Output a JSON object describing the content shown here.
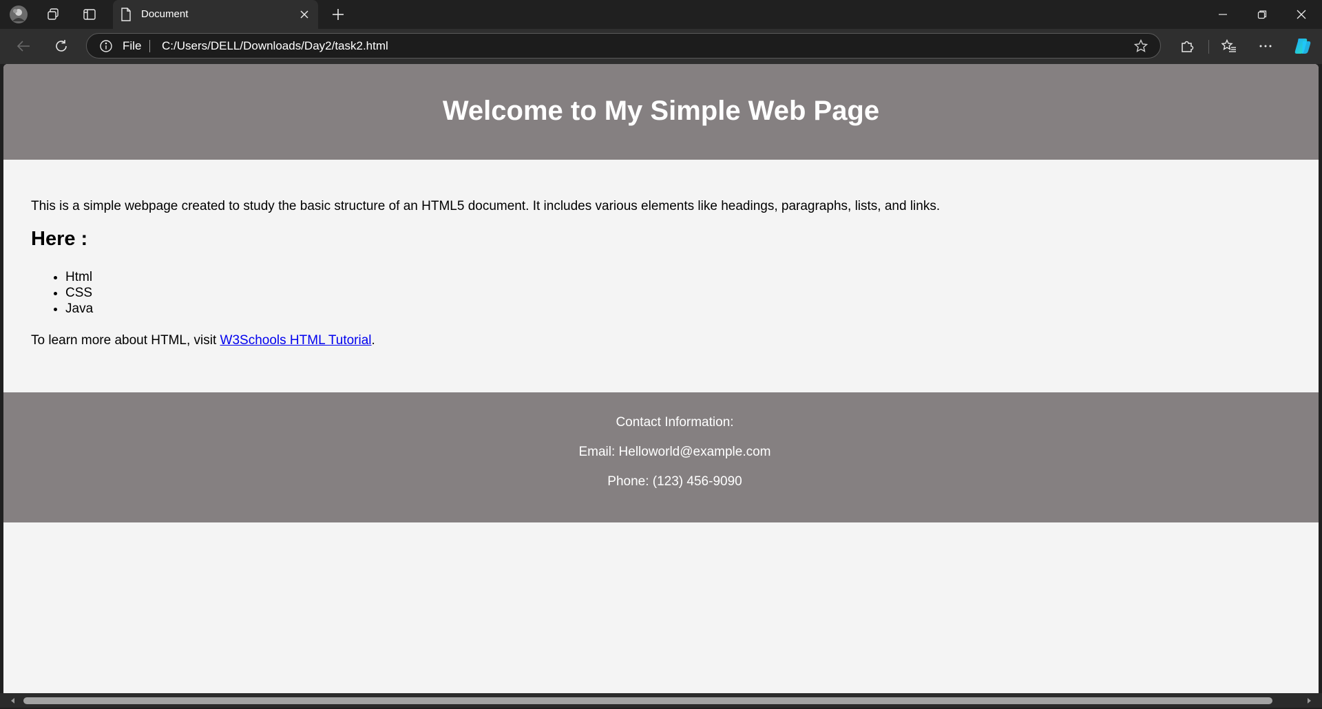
{
  "browser": {
    "tab": {
      "title": "Document"
    },
    "address": {
      "scheme_label": "File",
      "url": "C:/Users/DELL/Downloads/Day2/task2.html"
    },
    "icons": {
      "profile": "profile-avatar",
      "workspaces": "workspaces-icon",
      "tab_actions": "tab-actions-icon",
      "new_tab": "plus-icon",
      "back": "back-arrow-icon",
      "refresh": "refresh-icon",
      "info": "info-icon",
      "favorite": "star-icon",
      "extensions": "puzzle-icon",
      "favorites": "favorites-icon",
      "more": "more-icon",
      "copilot": "copilot-icon"
    }
  },
  "page": {
    "header": {
      "title": "Welcome to My Simple Web Page"
    },
    "main": {
      "intro": "This is a simple webpage created to study the basic structure of an HTML5 document. It includes various elements like headings, paragraphs, lists, and links.",
      "heading": "Here :",
      "items": [
        "Html",
        "CSS",
        "Java"
      ],
      "learn_prefix": "To learn more about HTML, visit ",
      "link_text": "W3Schools HTML Tutorial",
      "learn_suffix": "."
    },
    "footer": {
      "contact_label": "Contact Information:",
      "email": "Email: Helloworld@example.com",
      "phone": "Phone: (123) 456-9090"
    }
  },
  "colors": {
    "header_bg": "#858081",
    "footer_bg": "#858081",
    "page_bg": "#f4f4f4",
    "link": "#0000ee",
    "chrome_dark": "#202020",
    "chrome_toolbar": "#2f2f2f"
  }
}
